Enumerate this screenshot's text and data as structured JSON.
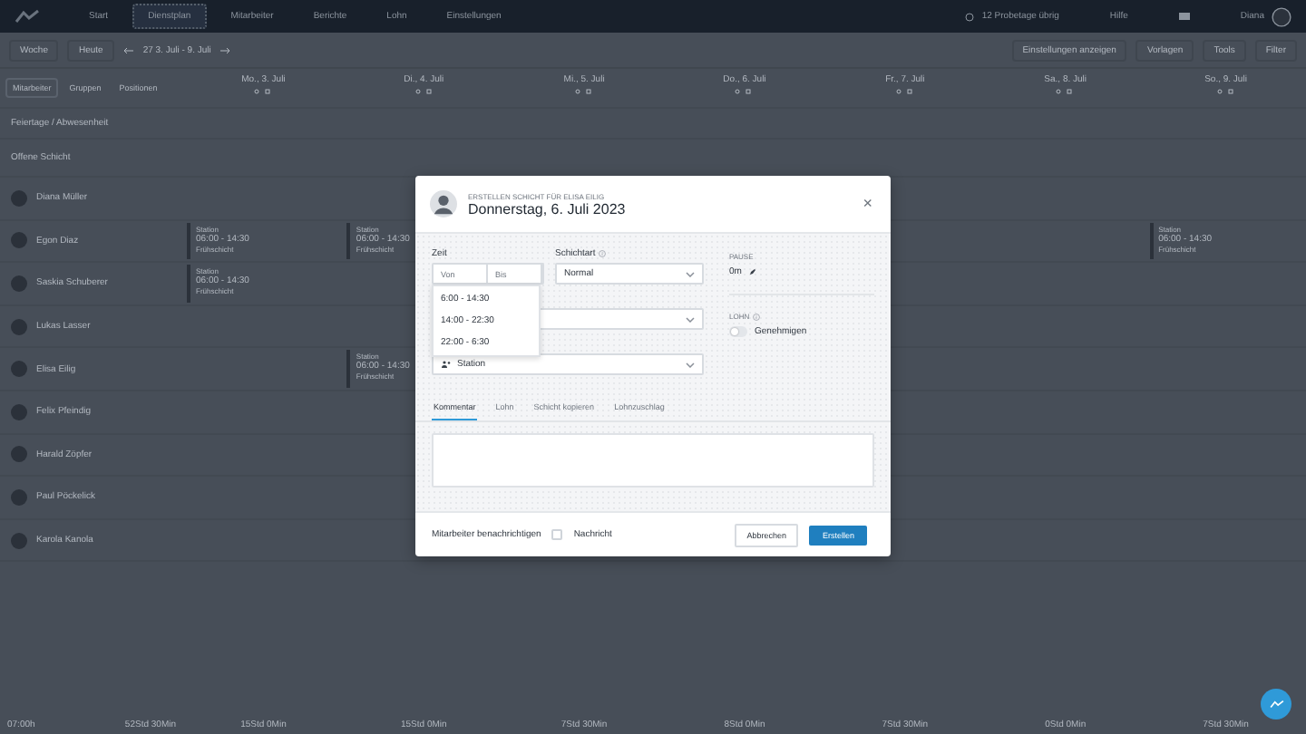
{
  "nav": {
    "items": [
      {
        "label": "Start",
        "selected": false
      },
      {
        "label": "Dienstplan",
        "selected": true
      },
      {
        "label": "Mitarbeiter",
        "selected": false
      },
      {
        "label": "Berichte",
        "selected": false
      },
      {
        "label": "Lohn",
        "selected": false
      },
      {
        "label": "Einstellungen",
        "selected": false
      }
    ],
    "trial": "12 Probetage übrig",
    "help": "Hilfe",
    "user": "Diana"
  },
  "toolbar": {
    "view": "Woche",
    "today": "Heute",
    "range": "27  3. Juli - 9. Juli",
    "actions": [
      "Einstellungen anzeigen",
      "Vorlagen",
      "Tools",
      "Filter"
    ]
  },
  "side_tabs": [
    {
      "label": "Mitarbeiter",
      "selected": true
    },
    {
      "label": "Gruppen",
      "selected": false
    },
    {
      "label": "Positionen",
      "selected": false
    }
  ],
  "holidays": "Feiertage / Abwesenheit",
  "open_shift": "Offene Schicht",
  "days": [
    "Mo., 3. Juli",
    "Di., 4. Juli",
    "Mi., 5. Juli",
    "Do., 6. Juli",
    "Fr., 7. Juli",
    "Sa., 8. Juli",
    "So., 9. Juli"
  ],
  "employees": [
    {
      "name": "Diana Müller"
    },
    {
      "name": "Egon Diaz",
      "days": [
        {
          "kind": "shift",
          "position": "Station",
          "time": "06:00  -  14:30",
          "type": "Frühschicht"
        },
        {
          "kind": "shift",
          "position": "Station",
          "time": "06:00  -  14:30",
          "type": "Frühschicht"
        },
        {
          "kind": "empty"
        },
        {
          "kind": "empty"
        },
        {
          "kind": "empty"
        },
        {
          "kind": "empty"
        },
        {
          "kind": "shift",
          "position": "Station",
          "time": "06:00  -  14:30",
          "type": "Frühschicht"
        }
      ]
    },
    {
      "name": "Saskia Schuberer",
      "days": [
        {
          "kind": "shift",
          "position": "Station",
          "time": "06:00  -  14:30",
          "type": "Frühschicht"
        }
      ]
    },
    {
      "name": "Lukas Lasser"
    },
    {
      "name": "Elisa Eilig",
      "days": [
        {
          "kind": "empty"
        },
        {
          "kind": "shift",
          "position": "Station",
          "time": "06:00  -  14:30",
          "type": "Frühschicht"
        }
      ]
    },
    {
      "name": "Felix Pfeindig"
    },
    {
      "name": "Harald Zöpfer"
    },
    {
      "name": "Paul Pöckelick"
    },
    {
      "name": "Karola Kanola"
    }
  ],
  "totals": [
    "07:00h",
    "52Std 30Min",
    "15Std 0Min",
    "15Std 0Min",
    "7Std 30Min",
    "8Std 0Min",
    "7Std 30Min",
    "0Std 0Min",
    "7Std 30Min"
  ],
  "modal": {
    "eyebrow": "ERSTELLEN SCHICHT FÜR ELISA EILIG",
    "title": "Donnerstag, 6. Juli 2023",
    "close": "×",
    "time_label": "Zeit",
    "from_placeholder": "Von",
    "to_placeholder": "Bis",
    "type_label": "Schichtart",
    "type_value": "Normal",
    "time_options": [
      "6:00 - 14:30",
      "14:00 - 22:30",
      "22:00 - 6:30"
    ],
    "position_value": "Station",
    "pause_label": "PAUSE",
    "pause_value": "0m",
    "wage_label": "LOHN",
    "approve_label": "Genehmigen",
    "approve_on": false,
    "tabs": [
      {
        "label": "Kommentar",
        "selected": true
      },
      {
        "label": "Lohn",
        "selected": false
      },
      {
        "label": "Schicht kopieren",
        "selected": false
      },
      {
        "label": "Lohnzuschlag",
        "selected": false
      }
    ],
    "notify_label": "Mitarbeiter benachrichtigen",
    "message_label": "Nachricht",
    "message_checked": false,
    "cancel": "Abbrechen",
    "submit": "Erstellen"
  }
}
